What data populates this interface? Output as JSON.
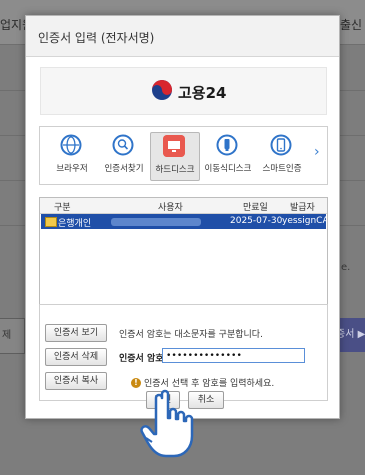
{
  "background": {
    "header_fragments": [
      "업지원",
      "출신"
    ],
    "side_hint": "e.",
    "left_field": "제",
    "right_button": "증서 ▶"
  },
  "dialog": {
    "title": "인증서 입력 (전자서명)",
    "logo": {
      "text": "고용24"
    },
    "stores": [
      {
        "label": "브라우저",
        "icon": "globe-icon"
      },
      {
        "label": "인증서찾기",
        "icon": "search-icon"
      },
      {
        "label": "하드디스크",
        "icon": "monitor-icon",
        "selected": true
      },
      {
        "label": "이동식디스크",
        "icon": "usb-icon"
      },
      {
        "label": "스마트인증",
        "icon": "smartphone-icon"
      }
    ],
    "store_next": "›",
    "table": {
      "headers": [
        "구분",
        "사용자",
        "만료일",
        "발급자"
      ],
      "rows": [
        {
          "type": "은행개인",
          "expiry": "2025-07-30",
          "issuer": "yessignCA"
        }
      ]
    },
    "buttons": {
      "view": "인증서 보기",
      "delete": "인증서 삭제",
      "copy": "인증서 복사",
      "ok": "확인",
      "cancel": "취소"
    },
    "notice_case": "인증서 암호는 대소문자를 구분합니다.",
    "password": {
      "label": "인증서 암호",
      "value": "••••••••••••••"
    },
    "warning": "인증서 선택 후 암호를 입력하세요."
  }
}
